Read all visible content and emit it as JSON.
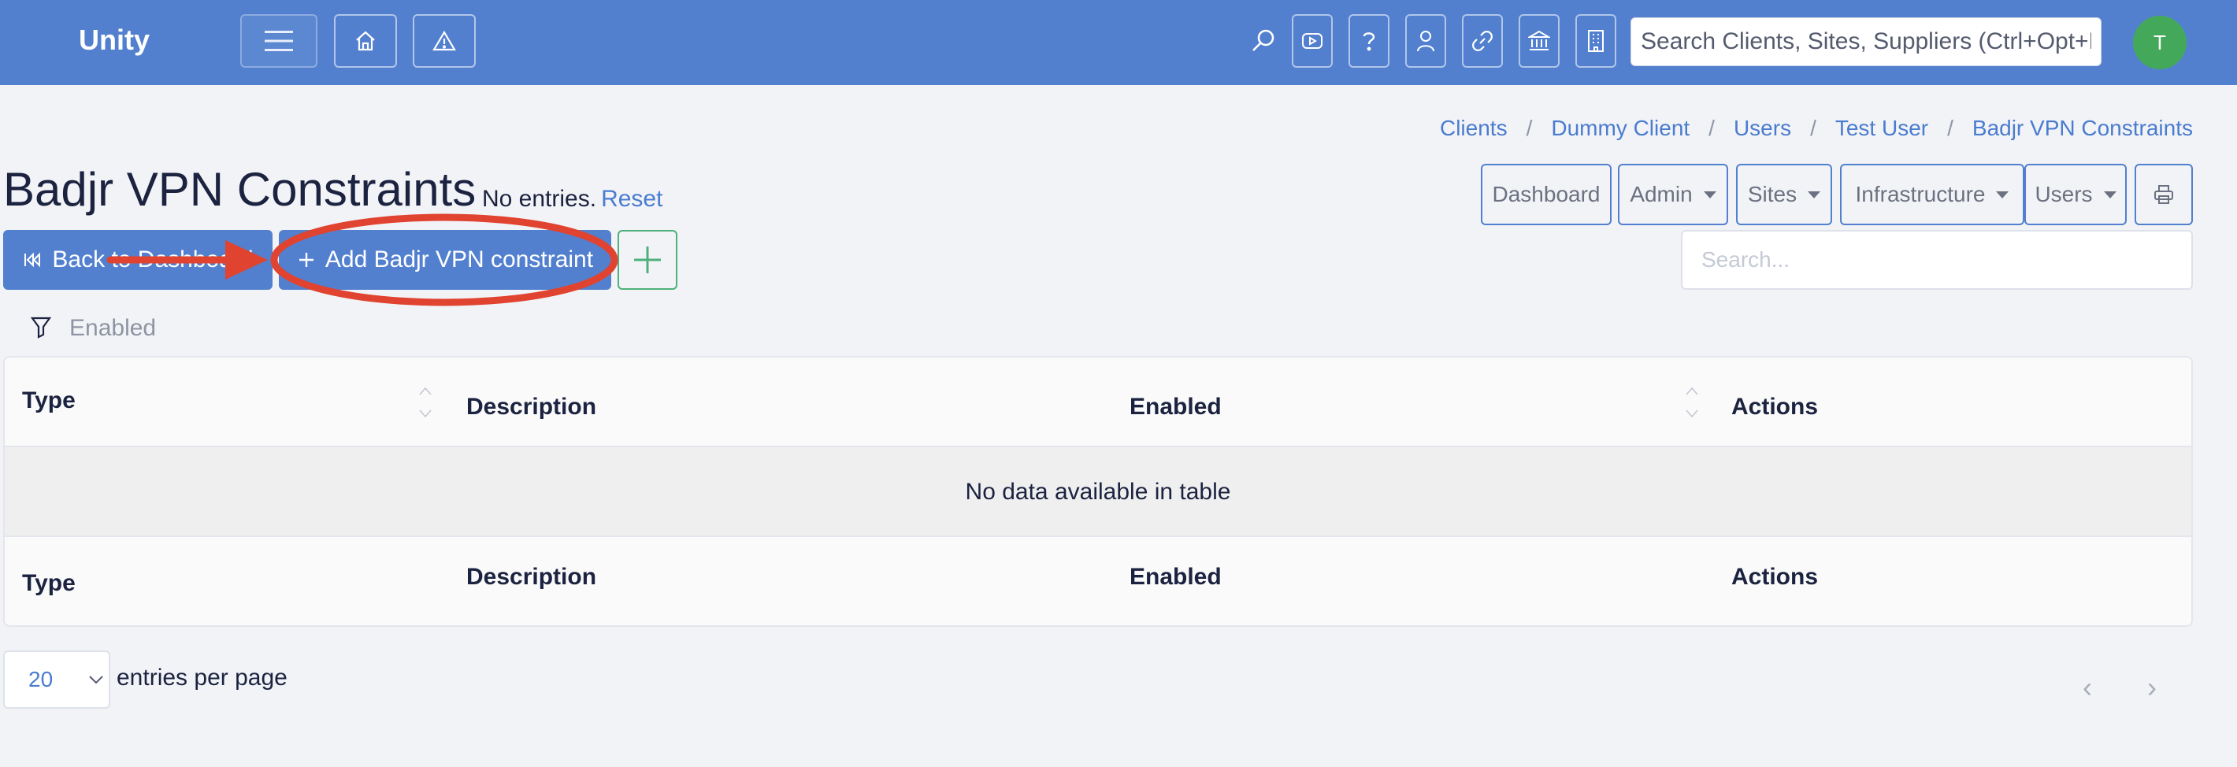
{
  "navbar": {
    "brand": "Unity",
    "global_search_placeholder": "Search Clients, Sites, Suppliers (Ctrl+Opt+F)",
    "avatar_initial": "T"
  },
  "breadcrumb": [
    {
      "label": "Clients"
    },
    {
      "label": "Dummy Client"
    },
    {
      "label": "Users"
    },
    {
      "label": "Test User"
    },
    {
      "label": "Badjr VPN Constraints"
    }
  ],
  "page": {
    "title": "Badjr VPN Constraints",
    "note": "No entries.",
    "reset_label": "Reset"
  },
  "toolbar": {
    "dashboard": "Dashboard",
    "admin": "Admin",
    "sites": "Sites",
    "infrastructure": "Infrastructure",
    "users": "Users"
  },
  "actions": {
    "back_label": "Back to Dashboard",
    "add_label": "Add Badjr VPN constraint",
    "search_placeholder": "Search..."
  },
  "filter": {
    "label": "Enabled"
  },
  "table": {
    "columns": [
      "Type",
      "Description",
      "Enabled",
      "Actions"
    ],
    "empty_message": "No data available in table"
  },
  "pagination": {
    "page_size": "20",
    "per_page_label": "entries per page",
    "prev": "‹",
    "next": "›"
  },
  "colors": {
    "navbar": "#5280cf",
    "primary": "#5280cf",
    "success": "#4eb07a",
    "avatar": "#44a85a",
    "annotation": "#e0432f"
  }
}
